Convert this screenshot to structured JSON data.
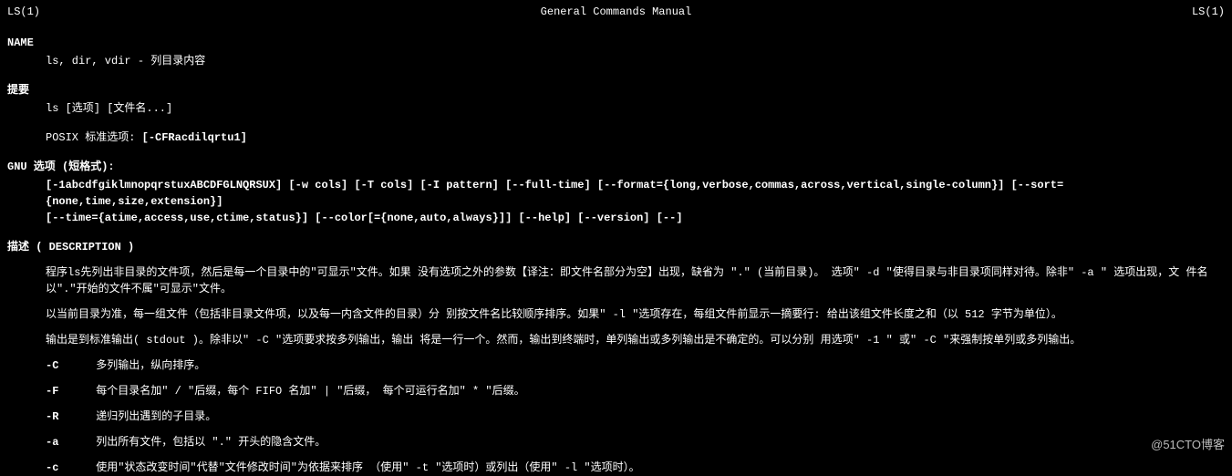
{
  "header": {
    "left": "LS(1)",
    "center": "General Commands Manual",
    "right": "LS(1)"
  },
  "sections": {
    "name": {
      "title": "NAME",
      "content": "ls, dir, vdir - 列目录内容"
    },
    "synopsis": {
      "title": "提要",
      "usage": "ls [选项] [文件名...]",
      "posix_label": "POSIX 标准选项:",
      "posix_opts": "[-CFRacdilqrtu1]"
    },
    "gnu": {
      "title": "GNU 选项 (短格式):",
      "line1": "[-1abcdfgiklmnopqrstuxABCDFGLNQRSUX]  [-w cols] [-T cols] [-I pattern] [--full-time] [--format={long,verbose,commas,across,vertical,single-column}] [--sort={none,time,size,extension}]",
      "line2": "[--time={atime,access,use,ctime,status}] [--color[={none,auto,always}]] [--help] [--version] [--]"
    },
    "description": {
      "title": "描述 ( DESCRIPTION )",
      "p1": "程序ls先列出非目录的文件项，然后是每一个目录中的\"可显示\"文件。如果       没有选项之外的参数【译注：即文件名部分为空】出现，缺省为       \".\"       (当前目录)。       选项\"       -d \"使得目录与非目录项同样对待。除非\" -a \" 选项出现，文 件名以\".\"开始的文件不属\"可显示\"文件。",
      "p2": "以当前目录为准，每一组文件（包括非目录文件项，以及每一内含文件的目录）分     别按文件名比较顺序排序。如果\"    -l    \"选项存在，每组文件前显示一摘要行:     给出该组文件长度之和（以    512 字节为单位）。",
      "p3": "输出是到标准输出(    stdout    )。除非以\"    -C   \"选项要求按多列输出，输出    将是一行一个。然而，输出到终端时，单列输出或多列输出是不确定的。可以分别    用选项\"    -1    \"    或\"    -C \"来强制按单列或多列输出。",
      "options": [
        {
          "flag": "-C",
          "desc": "多列输出，纵向排序。"
        },
        {
          "flag": "-F",
          "desc": "每个目录名加\" / \"后缀，每个 FIFO 名加\" | \"后缀，  每个可运行名加\" * \"后缀。"
        },
        {
          "flag": "-R",
          "desc": "递归列出遇到的子目录。"
        },
        {
          "flag": "-a",
          "desc": "列出所有文件，包括以 \".\" 开头的隐含文件。"
        },
        {
          "flag": "-c",
          "desc": "使用\"状态改变时间\"代替\"文件修改时间\"为依据来排序  （使用\" -t \"选项时）或列出（使用\" -l \"选项时）。"
        }
      ]
    }
  },
  "watermark": "@51CTO博客"
}
